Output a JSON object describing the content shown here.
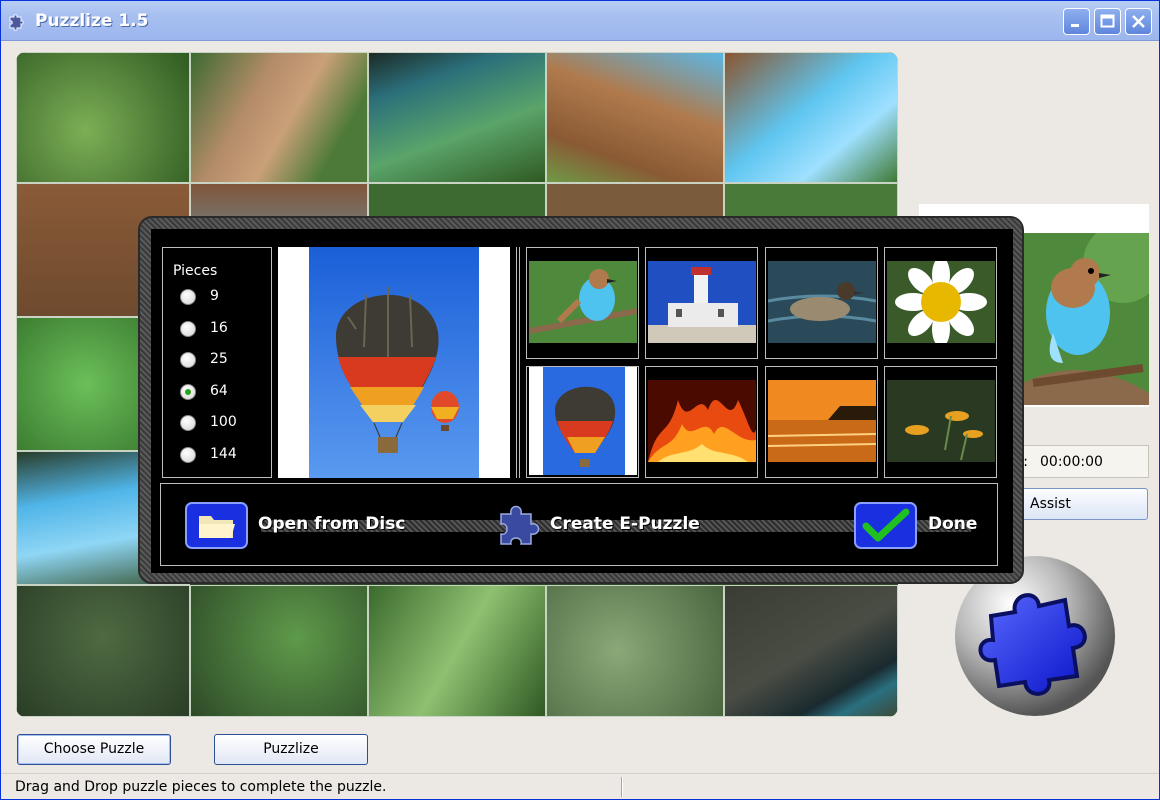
{
  "window": {
    "title": "Puzzlize 1.5"
  },
  "titlebar_buttons": {
    "minimize": "minimize-icon",
    "maximize": "maximize-icon",
    "close": "close-icon"
  },
  "dialog": {
    "pieces_label": "Pieces",
    "piece_options": [
      "9",
      "16",
      "25",
      "64",
      "100",
      "144"
    ],
    "selected_pieces": "64",
    "thumbnails": [
      "bird",
      "lighthouse",
      "duck",
      "daisy",
      "hot-air-balloon",
      "fire",
      "sunset-beach",
      "water-lilies"
    ],
    "actions": {
      "open_from_disc": "Open from Disc",
      "create_epuzzle": "Create E-Puzzle",
      "done": "Done"
    }
  },
  "side_panel": {
    "timer_value": "00:00:00",
    "timer_prefix": "s:",
    "assist_label": "Assist"
  },
  "buttons": {
    "choose_puzzle": "Choose Puzzle",
    "puzzlize": "Puzzlize"
  },
  "status": {
    "text": "Drag and Drop puzzle pieces to complete the puzzle."
  },
  "colors": {
    "title_text": "#ffffff",
    "accent_blue": "#1a2fe0",
    "dialog_bg": "#000000"
  }
}
